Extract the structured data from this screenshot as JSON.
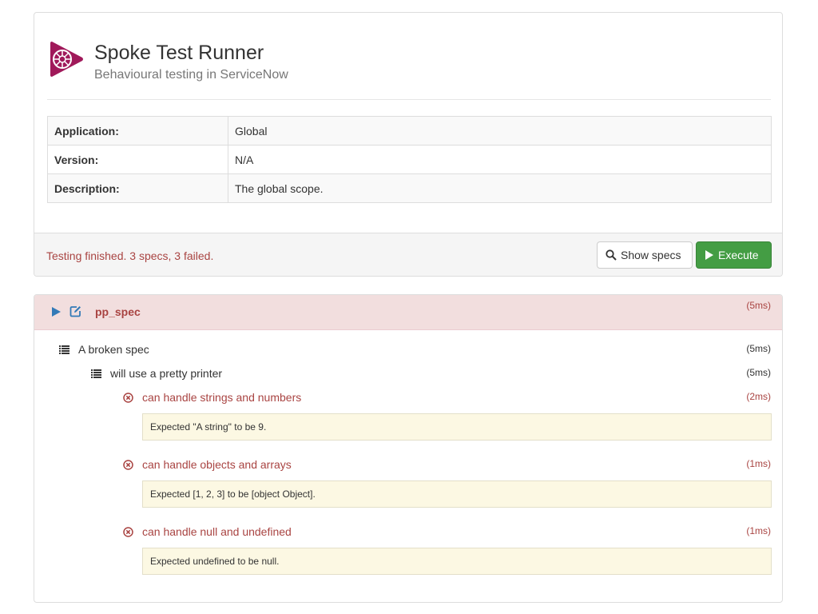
{
  "app": {
    "title": "Spoke Test Runner",
    "subtitle": "Behavioural testing in ServiceNow",
    "logo_icon": "spoke-logo-icon",
    "brand_color": "#a0195a"
  },
  "info": [
    {
      "key": "Application:",
      "value": "Global"
    },
    {
      "key": "Version:",
      "value": "N/A"
    },
    {
      "key": "Description:",
      "value": "The global scope."
    }
  ],
  "footer": {
    "status": "Testing finished. 3 specs, 3 failed.",
    "show_specs_label": "Show specs",
    "execute_label": "Execute"
  },
  "results": {
    "spec_name": "pp_spec",
    "spec_duration": "(5ms)",
    "suite": {
      "label": "A broken spec",
      "duration": "(5ms)"
    },
    "subsuite": {
      "label": "will use a pretty printer",
      "duration": "(5ms)"
    },
    "tests": [
      {
        "label": "can handle strings and numbers",
        "duration": "(2ms)",
        "message": "Expected \"A string\" to be 9."
      },
      {
        "label": "can handle objects and arrays",
        "duration": "(1ms)",
        "message": "Expected [1, 2, 3] to be [object Object]."
      },
      {
        "label": "can handle null and undefined",
        "duration": "(1ms)",
        "message": "Expected undefined to be null."
      }
    ]
  },
  "colors": {
    "danger": "#a94442",
    "success": "#449d44",
    "primary": "#337ab7",
    "warning_bg": "#fcf8e3"
  }
}
